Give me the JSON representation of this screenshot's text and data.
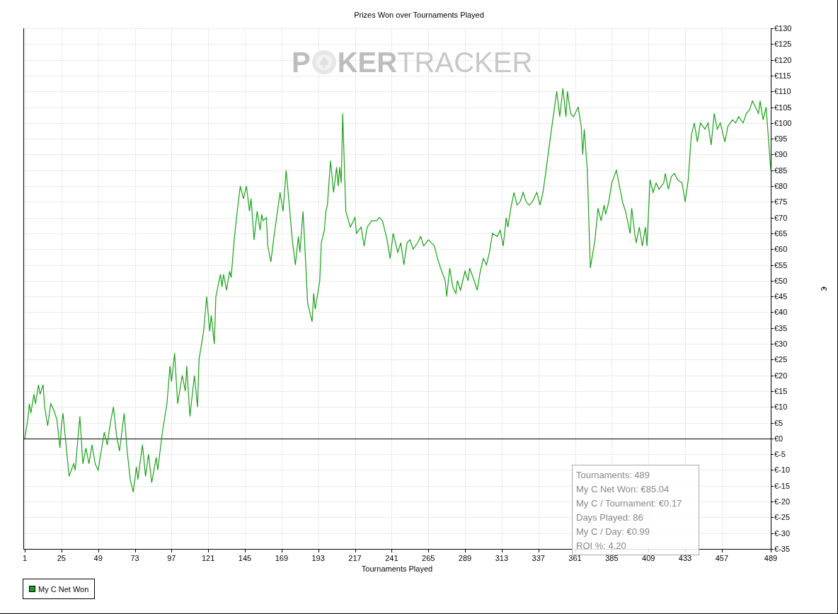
{
  "chart": {
    "logo": {
      "lead": "P",
      "strong": "KER",
      "light": "TRACKER"
    },
    "chart_data": {
      "type": "line",
      "grid": true,
      "title": "Prizes Won over Tournaments Played",
      "xlabel": "Tournaments Played",
      "ylabel": "€",
      "xlim": [
        1,
        489
      ],
      "ylim": [
        -35,
        130
      ],
      "xticks": [
        1,
        25,
        49,
        73,
        97,
        121,
        145,
        169,
        193,
        217,
        241,
        265,
        289,
        313,
        337,
        361,
        385,
        409,
        433,
        457,
        489
      ],
      "yticks": [
        {
          "value": 130,
          "label": "€130"
        },
        {
          "value": 125,
          "label": "€125"
        },
        {
          "value": 120,
          "label": "€120"
        },
        {
          "value": 115,
          "label": "€115"
        },
        {
          "value": 110,
          "label": "€110"
        },
        {
          "value": 105,
          "label": "€105"
        },
        {
          "value": 100,
          "label": "€100"
        },
        {
          "value": 95,
          "label": "€95"
        },
        {
          "value": 90,
          "label": "€90"
        },
        {
          "value": 85,
          "label": "€85"
        },
        {
          "value": 80,
          "label": "€80"
        },
        {
          "value": 75,
          "label": "€75"
        },
        {
          "value": 70,
          "label": "€70"
        },
        {
          "value": 65,
          "label": "€65"
        },
        {
          "value": 60,
          "label": "€60"
        },
        {
          "value": 55,
          "label": "€55"
        },
        {
          "value": 50,
          "label": "€50"
        },
        {
          "value": 45,
          "label": "€45"
        },
        {
          "value": 40,
          "label": "€40"
        },
        {
          "value": 35,
          "label": "€35"
        },
        {
          "value": 30,
          "label": "€30"
        },
        {
          "value": 25,
          "label": "€25"
        },
        {
          "value": 20,
          "label": "€20"
        },
        {
          "value": 15,
          "label": "€15"
        },
        {
          "value": 10,
          "label": "€10"
        },
        {
          "value": 5,
          "label": "€5"
        },
        {
          "value": 0,
          "label": "€0"
        },
        {
          "value": -5,
          "label": "€-5"
        },
        {
          "value": -10,
          "label": "€-10"
        },
        {
          "value": -15,
          "label": "€-15"
        },
        {
          "value": -20,
          "label": "€-20"
        },
        {
          "value": -25,
          "label": "€-25"
        },
        {
          "value": -30,
          "label": "€-30"
        },
        {
          "value": -35,
          "label": "€-35"
        }
      ],
      "x": [
        1,
        3,
        4,
        5,
        7,
        8,
        10,
        11,
        13,
        14,
        16,
        18,
        20,
        22,
        24,
        25,
        26,
        28,
        30,
        33,
        34,
        37,
        39,
        41,
        43,
        45,
        47,
        49,
        53,
        55,
        57,
        59,
        61,
        63,
        66,
        68,
        70,
        72,
        74,
        75,
        78,
        80,
        82,
        84,
        87,
        88,
        91,
        94,
        96,
        97,
        99,
        101,
        104,
        106,
        107,
        109,
        112,
        114,
        115,
        118,
        120,
        122,
        123,
        125,
        126,
        129,
        130,
        131,
        133,
        135,
        136,
        138,
        140,
        142,
        144,
        146,
        148,
        149,
        151,
        153,
        155,
        156,
        157,
        159,
        160,
        162,
        164,
        166,
        168,
        170,
        172,
        174,
        176,
        178,
        180,
        181,
        183,
        184,
        186,
        189,
        190,
        191,
        194,
        195,
        197,
        198,
        199,
        201,
        203,
        205,
        206,
        207,
        208,
        209,
        211,
        214,
        217,
        218,
        221,
        223,
        225,
        228,
        231,
        233,
        235,
        238,
        240,
        242,
        245,
        247,
        249,
        251,
        253,
        255,
        258,
        260,
        262,
        265,
        267,
        269,
        271,
        273,
        276,
        277,
        279,
        281,
        283,
        284,
        286,
        289,
        291,
        292,
        295,
        297,
        299,
        301,
        303,
        305,
        307,
        310,
        312,
        314,
        316,
        317,
        319,
        321,
        323,
        325,
        327,
        329,
        331,
        333,
        336,
        338,
        340,
        342,
        345,
        347,
        349,
        351,
        353,
        355,
        356,
        358,
        360,
        363,
        365,
        366,
        367,
        369,
        371,
        374,
        376,
        378,
        380,
        381,
        383,
        385,
        388,
        390,
        392,
        394,
        397,
        398,
        400,
        401,
        403,
        405,
        407,
        408,
        410,
        412,
        414,
        416,
        419,
        420,
        422,
        424,
        426,
        428,
        431,
        433,
        435,
        437,
        439,
        441,
        443,
        446,
        448,
        450,
        452,
        454,
        456,
        459,
        461,
        464,
        466,
        468,
        471,
        473,
        475,
        477,
        479,
        481,
        482,
        484,
        486,
        489
      ],
      "series": [
        {
          "name": "My C Net Won",
          "color": "#1aa01a",
          "values": [
            0,
            6,
            11,
            8,
            14,
            11,
            17,
            14,
            17,
            10,
            4,
            11,
            9,
            6,
            -3,
            4,
            8,
            -2,
            -12,
            -8,
            -10,
            7,
            -8,
            -3,
            -8,
            -2,
            -8,
            -10,
            2,
            -2,
            5,
            10,
            1,
            -4,
            8,
            -4,
            -13,
            -17,
            -9,
            -13,
            -2,
            -12,
            -5,
            -14,
            -6,
            -10,
            2,
            11,
            23,
            18,
            27,
            11,
            20,
            15,
            23,
            7,
            20,
            10,
            25,
            34,
            45,
            34,
            39,
            30,
            45,
            52,
            48,
            52,
            47,
            53,
            51,
            63,
            72,
            80,
            76,
            80,
            72,
            76,
            63,
            72,
            66,
            71,
            69,
            70,
            61,
            56,
            64,
            71,
            78,
            72,
            85,
            74,
            63,
            55,
            64,
            59,
            72,
            63,
            43,
            37,
            46,
            41,
            50,
            62,
            66,
            72,
            74,
            88,
            78,
            86,
            80,
            86,
            81,
            103,
            72,
            67,
            70,
            65,
            67,
            61,
            67,
            69,
            69,
            70,
            69,
            63,
            57,
            65,
            59,
            62,
            55,
            62,
            63,
            60,
            62,
            64,
            61,
            63,
            62,
            61,
            57,
            54,
            50,
            45,
            54,
            48,
            46,
            50,
            47,
            53,
            50,
            54,
            50,
            47,
            53,
            57,
            55,
            59,
            65,
            64,
            66,
            61,
            70,
            67,
            73,
            78,
            74,
            75,
            78,
            75,
            74,
            75,
            78,
            74,
            78,
            85,
            96,
            103,
            110,
            102,
            111,
            102,
            110,
            103,
            102,
            105,
            99,
            90,
            98,
            85,
            54,
            63,
            73,
            69,
            74,
            71,
            75,
            81,
            85,
            80,
            75,
            72,
            65,
            73,
            65,
            62,
            67,
            61,
            67,
            61,
            82,
            78,
            81,
            79,
            81,
            84,
            79,
            83,
            84,
            82,
            81,
            75,
            82,
            96,
            100,
            94,
            100,
            98,
            100,
            93,
            103,
            98,
            100,
            94,
            99,
            101,
            100,
            102,
            100,
            103,
            104,
            107,
            105,
            103,
            107,
            101,
            105,
            85
          ]
        }
      ]
    },
    "stats": [
      "Tournaments: 489",
      "My C Net Won: €85.04",
      "My C / Tournament: €0.17",
      "Days Played: 86",
      "My C / Day: €0.99",
      "ROI %: 4.20"
    ]
  }
}
